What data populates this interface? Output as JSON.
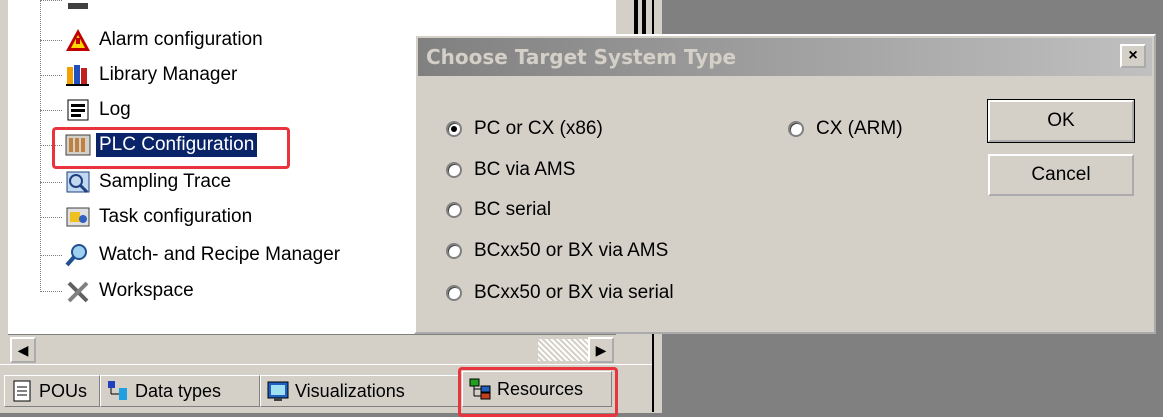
{
  "tree": {
    "items": [
      {
        "label": "Alarm configuration",
        "icon": "alarm-icon"
      },
      {
        "label": "Library Manager",
        "icon": "library-icon"
      },
      {
        "label": "Log",
        "icon": "log-icon"
      },
      {
        "label": "PLC Configuration",
        "icon": "plc-config-icon",
        "selected": true
      },
      {
        "label": "Sampling Trace",
        "icon": "sampling-trace-icon"
      },
      {
        "label": "Task configuration",
        "icon": "task-config-icon"
      },
      {
        "label": "Watch- and Recipe Manager",
        "icon": "magnifier-icon"
      },
      {
        "label": "Workspace",
        "icon": "tools-icon"
      }
    ]
  },
  "tabs": [
    {
      "label": "POUs",
      "icon": "pou-icon"
    },
    {
      "label": "Data types",
      "icon": "data-types-icon"
    },
    {
      "label": "Visualizations",
      "icon": "visualization-icon"
    },
    {
      "label": "Resources",
      "icon": "resources-icon",
      "active": true
    }
  ],
  "dialog": {
    "title": "Choose Target System Type",
    "close_label": "×",
    "options": [
      {
        "label": "PC or CX (x86)",
        "checked": true
      },
      {
        "label": "CX (ARM)",
        "checked": false
      },
      {
        "label": "BC via AMS",
        "checked": false
      },
      {
        "label": "BC serial",
        "checked": false
      },
      {
        "label": "BCxx50 or BX via AMS",
        "checked": false
      },
      {
        "label": "BCxx50 or BX via serial",
        "checked": false
      }
    ],
    "ok_label": "OK",
    "cancel_label": "Cancel"
  },
  "colors": {
    "highlight": "#e8343c",
    "selection": "#0a246a"
  }
}
